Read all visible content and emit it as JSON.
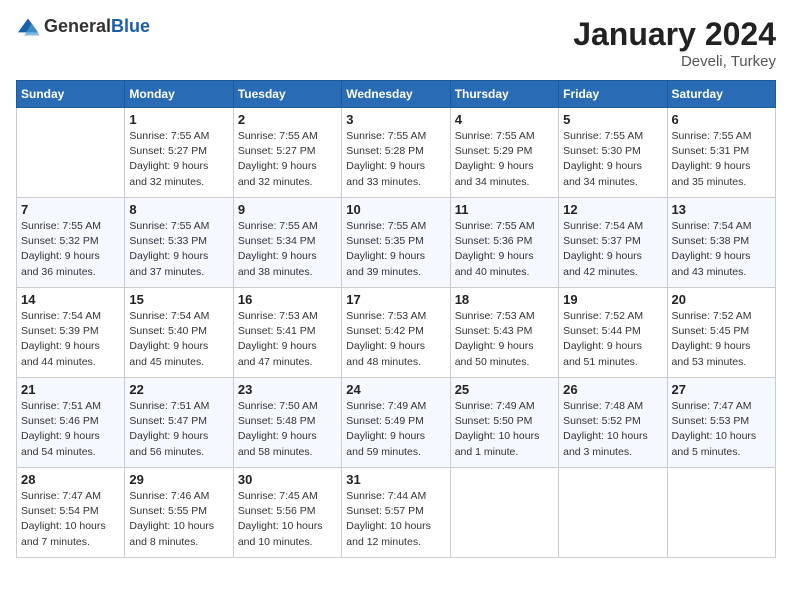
{
  "header": {
    "logo": {
      "general": "General",
      "blue": "Blue"
    },
    "title": "January 2024",
    "location": "Develi, Turkey"
  },
  "weekdays": [
    "Sunday",
    "Monday",
    "Tuesday",
    "Wednesday",
    "Thursday",
    "Friday",
    "Saturday"
  ],
  "weeks": [
    [
      {
        "day": "",
        "info": ""
      },
      {
        "day": "1",
        "info": "Sunrise: 7:55 AM\nSunset: 5:27 PM\nDaylight: 9 hours\nand 32 minutes."
      },
      {
        "day": "2",
        "info": "Sunrise: 7:55 AM\nSunset: 5:27 PM\nDaylight: 9 hours\nand 32 minutes."
      },
      {
        "day": "3",
        "info": "Sunrise: 7:55 AM\nSunset: 5:28 PM\nDaylight: 9 hours\nand 33 minutes."
      },
      {
        "day": "4",
        "info": "Sunrise: 7:55 AM\nSunset: 5:29 PM\nDaylight: 9 hours\nand 34 minutes."
      },
      {
        "day": "5",
        "info": "Sunrise: 7:55 AM\nSunset: 5:30 PM\nDaylight: 9 hours\nand 34 minutes."
      },
      {
        "day": "6",
        "info": "Sunrise: 7:55 AM\nSunset: 5:31 PM\nDaylight: 9 hours\nand 35 minutes."
      }
    ],
    [
      {
        "day": "7",
        "info": "Sunrise: 7:55 AM\nSunset: 5:32 PM\nDaylight: 9 hours\nand 36 minutes."
      },
      {
        "day": "8",
        "info": "Sunrise: 7:55 AM\nSunset: 5:33 PM\nDaylight: 9 hours\nand 37 minutes."
      },
      {
        "day": "9",
        "info": "Sunrise: 7:55 AM\nSunset: 5:34 PM\nDaylight: 9 hours\nand 38 minutes."
      },
      {
        "day": "10",
        "info": "Sunrise: 7:55 AM\nSunset: 5:35 PM\nDaylight: 9 hours\nand 39 minutes."
      },
      {
        "day": "11",
        "info": "Sunrise: 7:55 AM\nSunset: 5:36 PM\nDaylight: 9 hours\nand 40 minutes."
      },
      {
        "day": "12",
        "info": "Sunrise: 7:54 AM\nSunset: 5:37 PM\nDaylight: 9 hours\nand 42 minutes."
      },
      {
        "day": "13",
        "info": "Sunrise: 7:54 AM\nSunset: 5:38 PM\nDaylight: 9 hours\nand 43 minutes."
      }
    ],
    [
      {
        "day": "14",
        "info": "Sunrise: 7:54 AM\nSunset: 5:39 PM\nDaylight: 9 hours\nand 44 minutes."
      },
      {
        "day": "15",
        "info": "Sunrise: 7:54 AM\nSunset: 5:40 PM\nDaylight: 9 hours\nand 45 minutes."
      },
      {
        "day": "16",
        "info": "Sunrise: 7:53 AM\nSunset: 5:41 PM\nDaylight: 9 hours\nand 47 minutes."
      },
      {
        "day": "17",
        "info": "Sunrise: 7:53 AM\nSunset: 5:42 PM\nDaylight: 9 hours\nand 48 minutes."
      },
      {
        "day": "18",
        "info": "Sunrise: 7:53 AM\nSunset: 5:43 PM\nDaylight: 9 hours\nand 50 minutes."
      },
      {
        "day": "19",
        "info": "Sunrise: 7:52 AM\nSunset: 5:44 PM\nDaylight: 9 hours\nand 51 minutes."
      },
      {
        "day": "20",
        "info": "Sunrise: 7:52 AM\nSunset: 5:45 PM\nDaylight: 9 hours\nand 53 minutes."
      }
    ],
    [
      {
        "day": "21",
        "info": "Sunrise: 7:51 AM\nSunset: 5:46 PM\nDaylight: 9 hours\nand 54 minutes."
      },
      {
        "day": "22",
        "info": "Sunrise: 7:51 AM\nSunset: 5:47 PM\nDaylight: 9 hours\nand 56 minutes."
      },
      {
        "day": "23",
        "info": "Sunrise: 7:50 AM\nSunset: 5:48 PM\nDaylight: 9 hours\nand 58 minutes."
      },
      {
        "day": "24",
        "info": "Sunrise: 7:49 AM\nSunset: 5:49 PM\nDaylight: 9 hours\nand 59 minutes."
      },
      {
        "day": "25",
        "info": "Sunrise: 7:49 AM\nSunset: 5:50 PM\nDaylight: 10 hours\nand 1 minute."
      },
      {
        "day": "26",
        "info": "Sunrise: 7:48 AM\nSunset: 5:52 PM\nDaylight: 10 hours\nand 3 minutes."
      },
      {
        "day": "27",
        "info": "Sunrise: 7:47 AM\nSunset: 5:53 PM\nDaylight: 10 hours\nand 5 minutes."
      }
    ],
    [
      {
        "day": "28",
        "info": "Sunrise: 7:47 AM\nSunset: 5:54 PM\nDaylight: 10 hours\nand 7 minutes."
      },
      {
        "day": "29",
        "info": "Sunrise: 7:46 AM\nSunset: 5:55 PM\nDaylight: 10 hours\nand 8 minutes."
      },
      {
        "day": "30",
        "info": "Sunrise: 7:45 AM\nSunset: 5:56 PM\nDaylight: 10 hours\nand 10 minutes."
      },
      {
        "day": "31",
        "info": "Sunrise: 7:44 AM\nSunset: 5:57 PM\nDaylight: 10 hours\nand 12 minutes."
      },
      {
        "day": "",
        "info": ""
      },
      {
        "day": "",
        "info": ""
      },
      {
        "day": "",
        "info": ""
      }
    ]
  ]
}
